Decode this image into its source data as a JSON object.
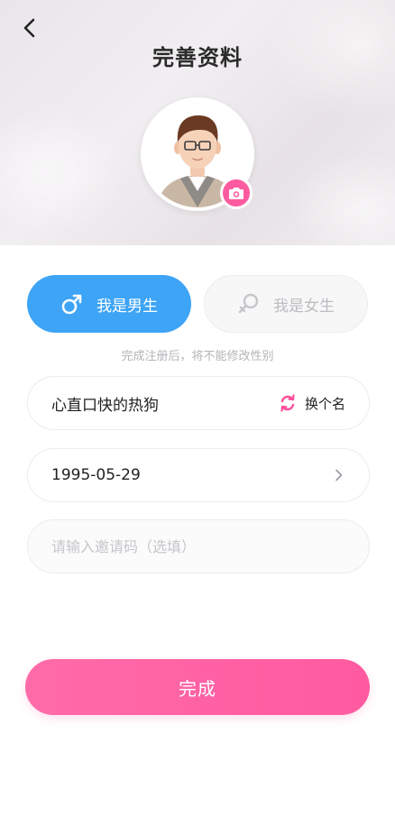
{
  "header": {
    "title": "完善资料",
    "back_icon": "chevron-left-icon"
  },
  "avatar": {
    "camera_icon": "camera-icon",
    "accent_color": "#fd5ba0"
  },
  "gender": {
    "male_label": "我是男生",
    "female_label": "我是女生",
    "selected": "male",
    "male_color": "#3da4f6",
    "note": "完成注册后，将不能修改性别"
  },
  "form": {
    "nickname": "心直口快的热狗",
    "change_name_label": "换个名",
    "birthday": "1995-05-29",
    "invite_placeholder": "请输入邀请码（选填）",
    "invite_value": ""
  },
  "submit": {
    "label": "完成",
    "color": "#ff5aa0"
  }
}
